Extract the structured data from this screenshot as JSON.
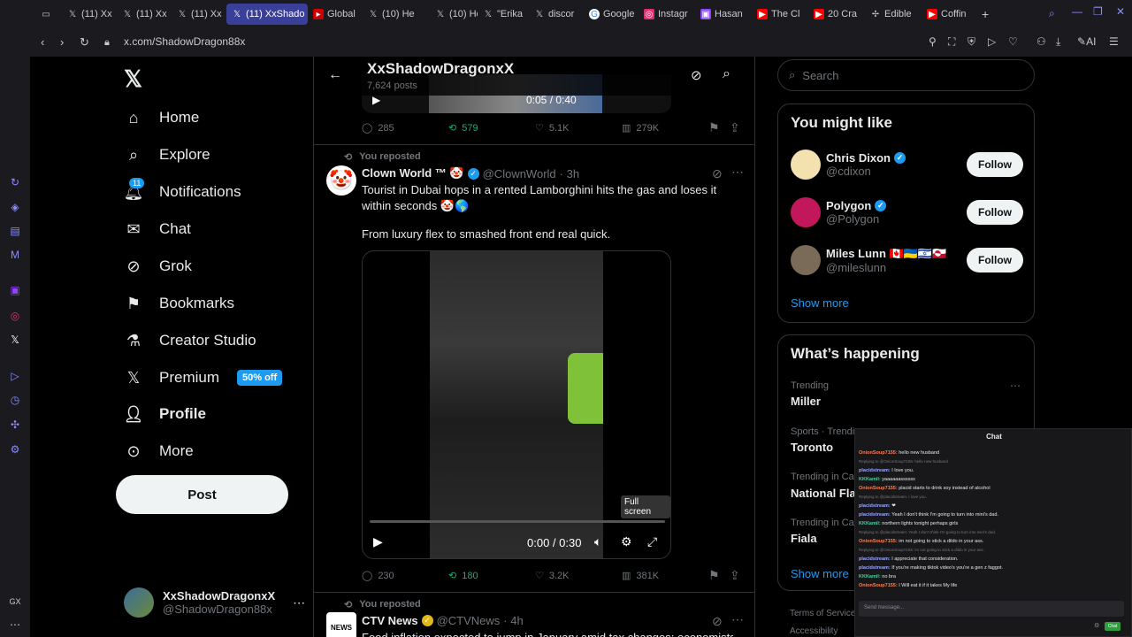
{
  "browser": {
    "tabs": [
      {
        "label": "",
        "icon": "window"
      },
      {
        "label": "(11) Xx",
        "icon": "X"
      },
      {
        "label": "(11) Xx",
        "icon": "X"
      },
      {
        "label": "(11) Xx",
        "icon": "X"
      },
      {
        "label": "(11) XxShado",
        "icon": "X",
        "active": true
      },
      {
        "label": "Global",
        "icon": "global"
      },
      {
        "label": "(10) He",
        "icon": "X"
      },
      {
        "label": "(10) He",
        "icon": "X"
      },
      {
        "label": "\"Erika",
        "icon": "X"
      },
      {
        "label": "discor",
        "icon": "X"
      },
      {
        "label": "Google",
        "icon": "google"
      },
      {
        "label": "Instagr",
        "icon": "instagram"
      },
      {
        "label": "Hasan",
        "icon": "twitch"
      },
      {
        "label": "The Cl",
        "icon": "youtube"
      },
      {
        "label": "20 Cra",
        "icon": "youtube"
      },
      {
        "label": "Edible",
        "icon": "edible"
      },
      {
        "label": "Coffin",
        "icon": "youtube"
      }
    ],
    "url": "x.com/ShadowDragon88x",
    "ai_label": "AI"
  },
  "nav": {
    "items": [
      {
        "label": "Home",
        "icon": "home-icon"
      },
      {
        "label": "Explore",
        "icon": "search-icon"
      },
      {
        "label": "Notifications",
        "icon": "bell-icon"
      },
      {
        "label": "Chat",
        "icon": "mail-icon"
      },
      {
        "label": "Grok",
        "icon": "grok-icon"
      },
      {
        "label": "Bookmarks",
        "icon": "bookmark-icon"
      },
      {
        "label": "Creator Studio",
        "icon": "flask-icon"
      },
      {
        "label": "Premium",
        "icon": "x-icon"
      },
      {
        "label": "Profile",
        "icon": "person-icon"
      },
      {
        "label": "More",
        "icon": "more-icon"
      }
    ],
    "notif_count": "11",
    "premium_badge": "50% off",
    "post_label": "Post"
  },
  "account": {
    "name": "XxShadowDragonxX",
    "handle": "@ShadowDragon88x"
  },
  "profile_header": {
    "title": "XxShadowDragonxX",
    "posts": "7,624 posts"
  },
  "top_video": {
    "time": "0:05 / 0:40"
  },
  "tweet1_actions": {
    "replies": "285",
    "reposts": "579",
    "likes": "5.1K",
    "views": "279K"
  },
  "tweet2": {
    "repost_label": "You reposted",
    "name": "Clown World ™ 🤡",
    "handle": "@ClownWorld",
    "time": "· 3h",
    "text1": "Tourist in Dubai hops in a rented Lamborghini hits the gas and loses it within seconds 🤡🌎",
    "text2": "From luxury flex to smashed front end real quick.",
    "video_time": "0:00 / 0:30",
    "fullscreen_tip": "Full screen",
    "replies": "230",
    "reposts": "180",
    "likes": "3.2K",
    "views": "381K"
  },
  "tweet3": {
    "repost_label": "You reposted",
    "name": "CTV News",
    "handle": "@CTVNews",
    "time": "· 4h",
    "text": "Food inflation expected to jump in January amid tax changes: economists"
  },
  "search": {
    "placeholder": "Search"
  },
  "might_like": {
    "title": "You might like",
    "users": [
      {
        "name": "Chris Dixon",
        "handle": "@cdixon",
        "follow": "Follow"
      },
      {
        "name": "Polygon",
        "handle": "@Polygon",
        "follow": "Follow"
      },
      {
        "name": "Miles Lunn 🇨🇦🇺🇦🇮🇱🇬🇱",
        "handle": "@mileslunn",
        "follow": "Follow"
      }
    ],
    "show_more": "Show more"
  },
  "happening": {
    "title": "What’s happening",
    "trends": [
      {
        "category": "Trending",
        "name": "Miller"
      },
      {
        "category": "Sports · Trending",
        "name": "Toronto"
      },
      {
        "category": "Trending in Canada",
        "name": "National Flag"
      },
      {
        "category": "Trending in Canada",
        "name": "Fiala"
      }
    ],
    "show_more": "Show more"
  },
  "footer": {
    "terms": "Terms of Service",
    "accessibility": "Accessibility"
  },
  "chat": {
    "title": "Chat",
    "messages": [
      {
        "user": "OnionSoup7155",
        "text": "hello new husband",
        "style": "u"
      },
      {
        "reply": "Replying to @OnionSoup7155: hello new husband"
      },
      {
        "user": "placidstream",
        "text": "I love you.",
        "style": "u3"
      },
      {
        "user": "KKKamil",
        "text": "yaaaaaassssss",
        "style": "u2"
      },
      {
        "user": "OnionSoup7155",
        "text": "placid starts to drink soy instead of alcohol",
        "style": "u"
      },
      {
        "reply": "Replying to @placidstream: I love you."
      },
      {
        "user": "placidstream",
        "text": "❤",
        "style": "u3"
      },
      {
        "user": "placidstream",
        "text": "Yeah I don't think I'm going to turn into mini's dad.",
        "style": "u3"
      },
      {
        "user": "KKKamil",
        "text": "northern lights tonight perhaps girls",
        "style": "u2"
      },
      {
        "reply": "Replying to @placidstream: Yeah I don't think I'm going to turn into mini's dad."
      },
      {
        "user": "OnionSoup7155",
        "text": "im not going to stick a dildo in your ass.",
        "style": "u"
      },
      {
        "reply": "Replying to @OnionSoup7155: im not going to stick a dildo in your ass."
      },
      {
        "user": "placidstream",
        "text": "I appreciate that consideration.",
        "style": "u3"
      },
      {
        "user": "placidstream",
        "text": "If you're making tiktok video's you're a gen z faggot.",
        "style": "u3"
      },
      {
        "user": "KKKamil",
        "text": "no bra",
        "style": "u2"
      },
      {
        "user": "OnionSoup7155",
        "text": "I Will eat it if it takes My life",
        "style": "u"
      }
    ],
    "input_placeholder": "Send message...",
    "send_label": "Chat"
  }
}
